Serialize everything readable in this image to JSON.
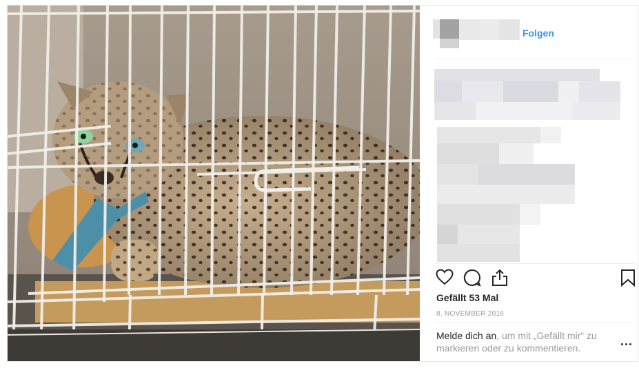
{
  "header": {
    "follow_label": "Folgen",
    "avatar": "blurred-avatar",
    "username": "blurred-username"
  },
  "caption": {
    "blurred": true
  },
  "actions": {
    "like_icon": "heart-icon",
    "comment_icon": "comment-icon",
    "share_icon": "share-icon",
    "save_icon": "bookmark-icon"
  },
  "likes_text": "Gefällt 53 Mal",
  "date_text": "8. NOVEMBER 2016",
  "login": {
    "link_text": "Melde dich an",
    "rest_text": ", um mit „Gefällt mir“ zu markieren oder zu kommentieren."
  },
  "more_label": "...",
  "colors": {
    "link_blue": "#3897f0",
    "text": "#262626",
    "muted": "#999999",
    "border": "#efefef"
  }
}
